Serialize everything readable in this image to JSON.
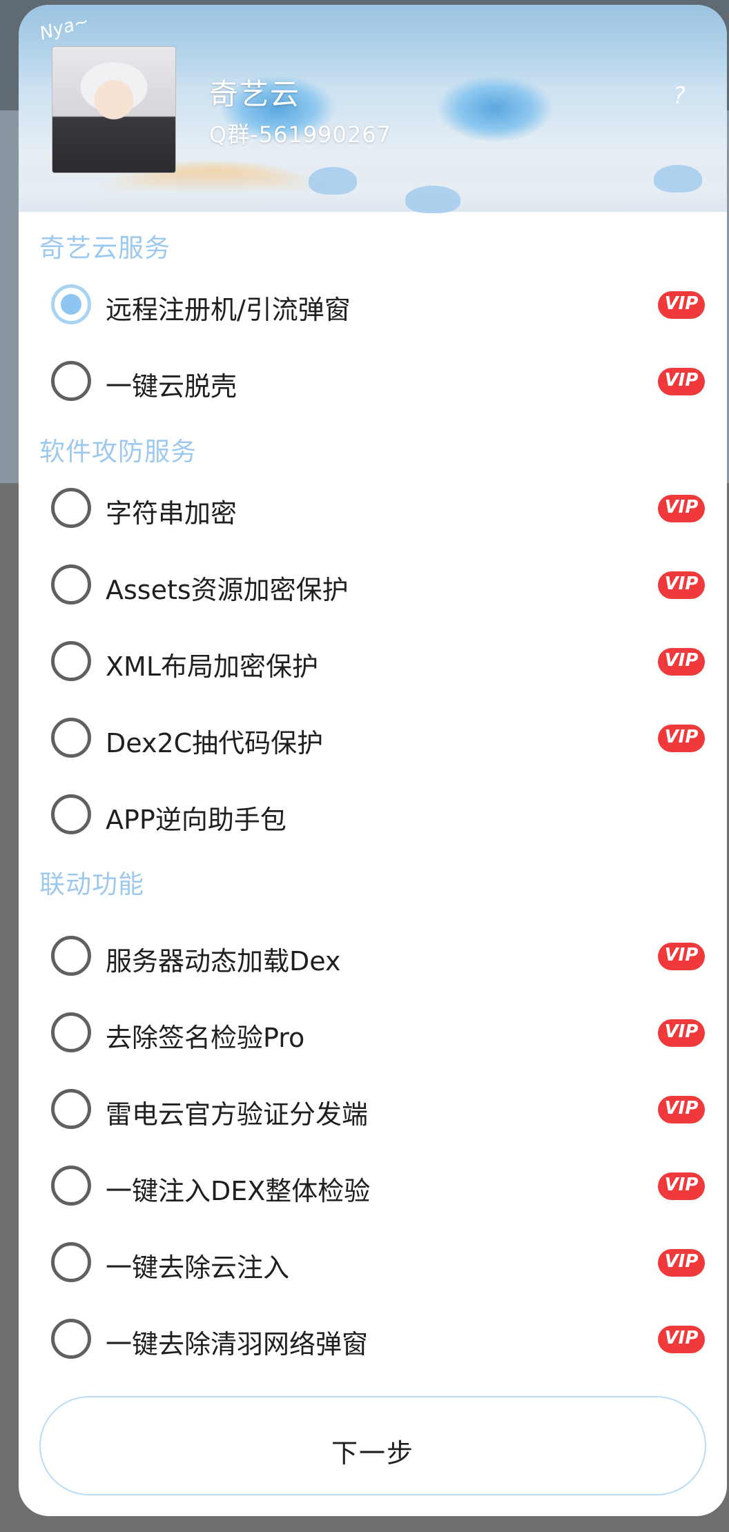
{
  "header": {
    "title": "奇艺云",
    "subtitle": "Q群-561990267",
    "deco_handwriting": "Nya~",
    "deco_question": "?"
  },
  "sections": [
    {
      "title": "奇艺云服务",
      "options": [
        {
          "label": "远程注册机/引流弹窗",
          "checked": true,
          "vip": true
        },
        {
          "label": "一键云脱壳",
          "checked": false,
          "vip": true
        }
      ]
    },
    {
      "title": "软件攻防服务",
      "options": [
        {
          "label": "字符串加密",
          "checked": false,
          "vip": true
        },
        {
          "label": "Assets资源加密保护",
          "checked": false,
          "vip": true
        },
        {
          "label": "XML布局加密保护",
          "checked": false,
          "vip": true
        },
        {
          "label": "Dex2C抽代码保护",
          "checked": false,
          "vip": true
        },
        {
          "label": "APP逆向助手包",
          "checked": false,
          "vip": false
        }
      ]
    },
    {
      "title": "联动功能",
      "options": [
        {
          "label": "服务器动态加载Dex",
          "checked": false,
          "vip": true
        },
        {
          "label": "去除签名检验Pro",
          "checked": false,
          "vip": true
        },
        {
          "label": "雷电云官方验证分发端",
          "checked": false,
          "vip": true
        },
        {
          "label": "一键注入DEX整体检验",
          "checked": false,
          "vip": true
        },
        {
          "label": "一键去除云注入",
          "checked": false,
          "vip": true
        },
        {
          "label": "一键去除清羽网络弹窗",
          "checked": false,
          "vip": true
        }
      ]
    }
  ],
  "vip_badge": "VIP",
  "next_button": "下一步",
  "colors": {
    "section_title": "#9ec9ee",
    "radio_checked": "#8ec6f1",
    "vip_badge": "#f0393a",
    "button_border": "#b8dcf6"
  }
}
